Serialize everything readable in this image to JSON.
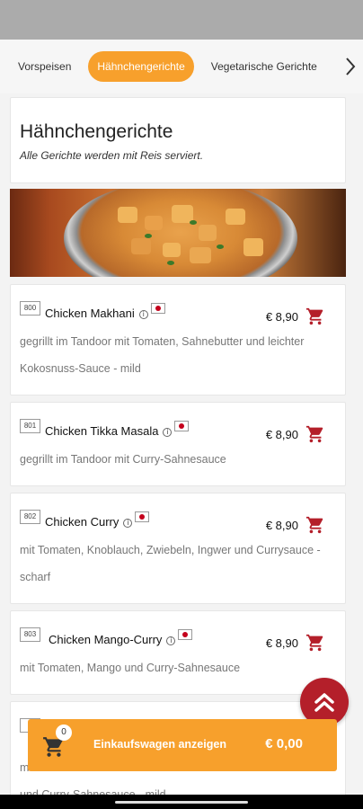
{
  "category_nav": {
    "tabs": [
      {
        "label": "Vorspeisen"
      },
      {
        "label": "Hähnchengerichte"
      },
      {
        "label": "Vegetarische Gerichte"
      }
    ]
  },
  "section": {
    "title": "Hähnchengerichte",
    "subtitle": "Alle Gerichte werden mit Reis serviert."
  },
  "dishes": [
    {
      "number": "800",
      "name": "Chicken Makhani",
      "price": "€ 8,90",
      "description": "gegrillt im Tandoor mit Tomaten, Sahnebutter und leichter Kokosnuss-Sauce - mild"
    },
    {
      "number": "801",
      "name": "Chicken Tikka Masala",
      "price": "€ 8,90",
      "description": "gegrillt im Tandoor mit Curry-Sahnesauce"
    },
    {
      "number": "802",
      "name": "Chicken Curry",
      "price": "€ 8,90",
      "description": "mit Tomaten, Knoblauch, Zwiebeln, Ingwer und Currysauce - scharf"
    },
    {
      "number": "803",
      "name": "Chicken Mango-Curry",
      "price": "€ 8,90",
      "description": "mit Tomaten, Mango und Curry-Sahnesauce"
    },
    {
      "number": "8",
      "name": "",
      "price": "",
      "description": "m\nund Curry-Sahnesauce - mild"
    }
  ],
  "cart": {
    "count": "0",
    "label": "Einkaufswagen anzeigen",
    "total": "€ 0,00"
  },
  "colors": {
    "accent": "#f7a02c",
    "cart_icon": "#b41f2a",
    "scroll_top": "#b41f2a"
  },
  "icons": {
    "nav_next": "chevron-right-icon",
    "info": "info-icon",
    "flag": "japan-flag-icon",
    "add_to_cart": "cart-icon",
    "scroll_top": "double-chevron-up-icon"
  }
}
